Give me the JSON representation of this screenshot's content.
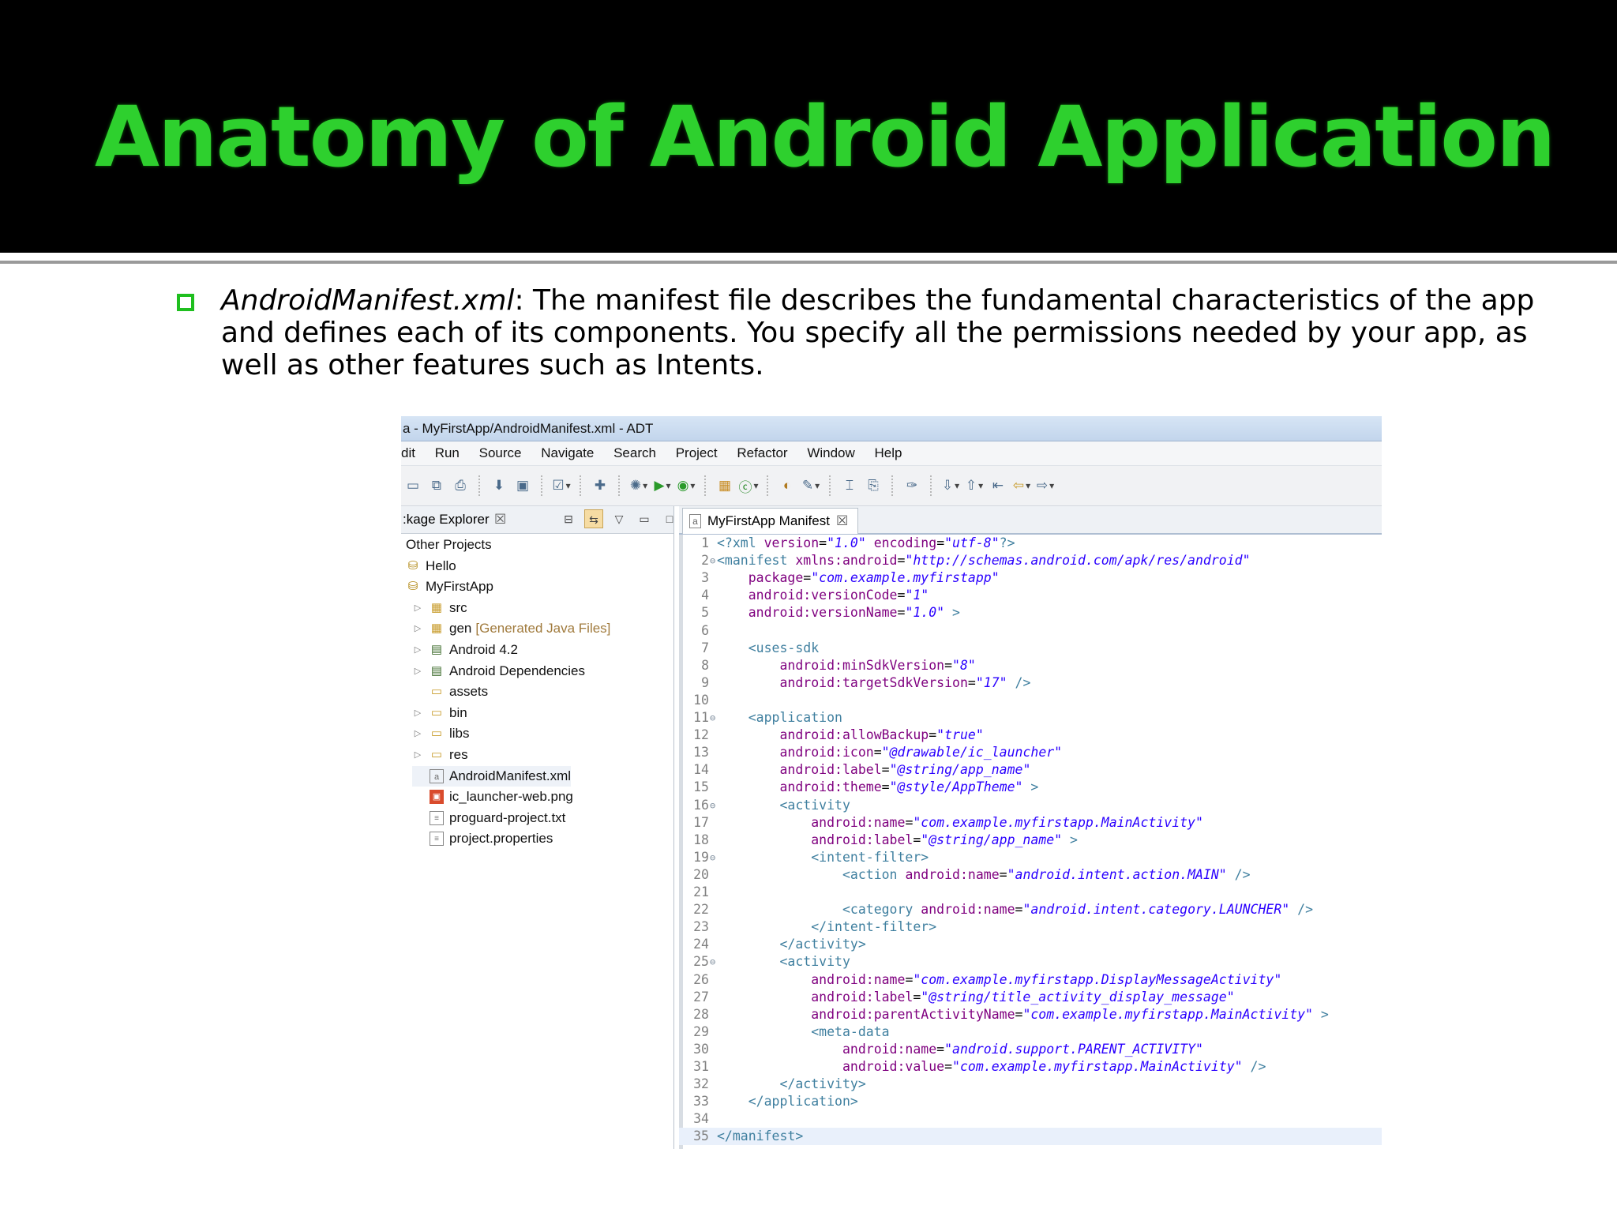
{
  "slide": {
    "title": "Anatomy of Android Application",
    "bullet": {
      "term": "AndroidManifest.xml",
      "text": ": The manifest file describes the fundamental characteristics of the app and defines each of its components. You specify all the permissions needed by your app, as well as other features such as Intents."
    }
  },
  "ide": {
    "window_title": "a - MyFirstApp/AndroidManifest.xml - ADT",
    "menu": [
      "dit",
      "Run",
      "Source",
      "Navigate",
      "Search",
      "Project",
      "Refactor",
      "Window",
      "Help"
    ],
    "package_explorer": {
      "tab_label": ":kage Explorer",
      "tree": [
        {
          "label": "Other Projects",
          "icon": "none",
          "level": 0,
          "expander": false
        },
        {
          "label": "Hello",
          "icon": "project-icon",
          "level": 0,
          "expander": false
        },
        {
          "label": "MyFirstApp",
          "icon": "project-icon",
          "level": 0,
          "expander": false
        },
        {
          "label": "src",
          "icon": "source-folder-icon",
          "level": 1,
          "expander": true
        },
        {
          "label": "gen",
          "decoration": "[Generated Java Files]",
          "icon": "source-folder-icon",
          "level": 1,
          "expander": true
        },
        {
          "label": "Android 4.2",
          "icon": "library-icon",
          "level": 1,
          "expander": true
        },
        {
          "label": "Android Dependencies",
          "icon": "library-icon",
          "level": 1,
          "expander": true
        },
        {
          "label": "assets",
          "icon": "folder-icon",
          "level": 1,
          "expander": false
        },
        {
          "label": "bin",
          "icon": "folder-icon",
          "level": 1,
          "expander": true
        },
        {
          "label": "libs",
          "icon": "folder-icon",
          "level": 1,
          "expander": true
        },
        {
          "label": "res",
          "icon": "folder-icon",
          "level": 1,
          "expander": true
        },
        {
          "label": "AndroidManifest.xml",
          "icon": "xml-file-icon",
          "level": 1,
          "expander": false,
          "selected": true
        },
        {
          "label": "ic_launcher-web.png",
          "icon": "image-file-icon",
          "level": 1,
          "expander": false
        },
        {
          "label": "proguard-project.txt",
          "icon": "text-file-icon",
          "level": 1,
          "expander": false
        },
        {
          "label": "project.properties",
          "icon": "text-file-icon",
          "level": 1,
          "expander": false
        }
      ]
    },
    "editor": {
      "tab_label": "MyFirstApp Manifest",
      "lines": [
        [
          {
            "c": "t",
            "s": "<?xml "
          },
          {
            "c": "a",
            "s": "version"
          },
          {
            "c": "p",
            "s": "="
          },
          {
            "c": "v",
            "s": "\"1.0\""
          },
          {
            "c": "p",
            "s": " "
          },
          {
            "c": "a",
            "s": "encoding"
          },
          {
            "c": "p",
            "s": "="
          },
          {
            "c": "v",
            "s": "\"utf-8\""
          },
          {
            "c": "t",
            "s": "?>"
          }
        ],
        [
          {
            "c": "t",
            "s": "<manifest "
          },
          {
            "c": "a",
            "s": "xmlns:android"
          },
          {
            "c": "p",
            "s": "="
          },
          {
            "c": "v",
            "s": "\"http://schemas.android.com/apk/res/android\""
          }
        ],
        [
          {
            "c": "p",
            "s": "    "
          },
          {
            "c": "a",
            "s": "package"
          },
          {
            "c": "p",
            "s": "="
          },
          {
            "c": "v",
            "s": "\"com.example.myfirstapp\""
          }
        ],
        [
          {
            "c": "p",
            "s": "    "
          },
          {
            "c": "a",
            "s": "android:versionCode"
          },
          {
            "c": "p",
            "s": "="
          },
          {
            "c": "v",
            "s": "\"1\""
          }
        ],
        [
          {
            "c": "p",
            "s": "    "
          },
          {
            "c": "a",
            "s": "android:versionName"
          },
          {
            "c": "p",
            "s": "="
          },
          {
            "c": "v",
            "s": "\"1.0\""
          },
          {
            "c": "t",
            "s": " >"
          }
        ],
        [],
        [
          {
            "c": "p",
            "s": "    "
          },
          {
            "c": "t",
            "s": "<uses-sdk"
          }
        ],
        [
          {
            "c": "p",
            "s": "        "
          },
          {
            "c": "a",
            "s": "android:minSdkVersion"
          },
          {
            "c": "p",
            "s": "="
          },
          {
            "c": "v",
            "s": "\"8\""
          }
        ],
        [
          {
            "c": "p",
            "s": "        "
          },
          {
            "c": "a",
            "s": "android:targetSdkVersion"
          },
          {
            "c": "p",
            "s": "="
          },
          {
            "c": "v",
            "s": "\"17\""
          },
          {
            "c": "t",
            "s": " />"
          }
        ],
        [],
        [
          {
            "c": "p",
            "s": "    "
          },
          {
            "c": "t",
            "s": "<application"
          }
        ],
        [
          {
            "c": "p",
            "s": "        "
          },
          {
            "c": "a",
            "s": "android:allowBackup"
          },
          {
            "c": "p",
            "s": "="
          },
          {
            "c": "v",
            "s": "\"true\""
          }
        ],
        [
          {
            "c": "p",
            "s": "        "
          },
          {
            "c": "a",
            "s": "android:icon"
          },
          {
            "c": "p",
            "s": "="
          },
          {
            "c": "v",
            "s": "\"@drawable/ic_launcher\""
          }
        ],
        [
          {
            "c": "p",
            "s": "        "
          },
          {
            "c": "a",
            "s": "android:label"
          },
          {
            "c": "p",
            "s": "="
          },
          {
            "c": "v",
            "s": "\"@string/app_name\""
          }
        ],
        [
          {
            "c": "p",
            "s": "        "
          },
          {
            "c": "a",
            "s": "android:theme"
          },
          {
            "c": "p",
            "s": "="
          },
          {
            "c": "v",
            "s": "\"@style/AppTheme\""
          },
          {
            "c": "t",
            "s": " >"
          }
        ],
        [
          {
            "c": "p",
            "s": "        "
          },
          {
            "c": "t",
            "s": "<activity"
          }
        ],
        [
          {
            "c": "p",
            "s": "            "
          },
          {
            "c": "a",
            "s": "android:name"
          },
          {
            "c": "p",
            "s": "="
          },
          {
            "c": "v",
            "s": "\"com.example.myfirstapp.MainActivity\""
          }
        ],
        [
          {
            "c": "p",
            "s": "            "
          },
          {
            "c": "a",
            "s": "android:label"
          },
          {
            "c": "p",
            "s": "="
          },
          {
            "c": "v",
            "s": "\"@string/app_name\""
          },
          {
            "c": "t",
            "s": " >"
          }
        ],
        [
          {
            "c": "p",
            "s": "            "
          },
          {
            "c": "t",
            "s": "<intent-filter>"
          }
        ],
        [
          {
            "c": "p",
            "s": "                "
          },
          {
            "c": "t",
            "s": "<action "
          },
          {
            "c": "a",
            "s": "android:name"
          },
          {
            "c": "p",
            "s": "="
          },
          {
            "c": "v",
            "s": "\"android.intent.action.MAIN\""
          },
          {
            "c": "t",
            "s": " />"
          }
        ],
        [],
        [
          {
            "c": "p",
            "s": "                "
          },
          {
            "c": "t",
            "s": "<category "
          },
          {
            "c": "a",
            "s": "android:name"
          },
          {
            "c": "p",
            "s": "="
          },
          {
            "c": "v",
            "s": "\"android.intent.category.LAUNCHER\""
          },
          {
            "c": "t",
            "s": " />"
          }
        ],
        [
          {
            "c": "p",
            "s": "            "
          },
          {
            "c": "t",
            "s": "</intent-filter>"
          }
        ],
        [
          {
            "c": "p",
            "s": "        "
          },
          {
            "c": "t",
            "s": "</activity>"
          }
        ],
        [
          {
            "c": "p",
            "s": "        "
          },
          {
            "c": "t",
            "s": "<activity"
          }
        ],
        [
          {
            "c": "p",
            "s": "            "
          },
          {
            "c": "a",
            "s": "android:name"
          },
          {
            "c": "p",
            "s": "="
          },
          {
            "c": "v",
            "s": "\"com.example.myfirstapp.DisplayMessageActivity\""
          }
        ],
        [
          {
            "c": "p",
            "s": "            "
          },
          {
            "c": "a",
            "s": "android:label"
          },
          {
            "c": "p",
            "s": "="
          },
          {
            "c": "v",
            "s": "\"@string/title_activity_display_message\""
          }
        ],
        [
          {
            "c": "p",
            "s": "            "
          },
          {
            "c": "a",
            "s": "android:parentActivityName"
          },
          {
            "c": "p",
            "s": "="
          },
          {
            "c": "v",
            "s": "\"com.example.myfirstapp.MainActivity\""
          },
          {
            "c": "t",
            "s": " >"
          }
        ],
        [
          {
            "c": "p",
            "s": "            "
          },
          {
            "c": "t",
            "s": "<meta-data"
          }
        ],
        [
          {
            "c": "p",
            "s": "                "
          },
          {
            "c": "a",
            "s": "android:name"
          },
          {
            "c": "p",
            "s": "="
          },
          {
            "c": "v",
            "s": "\"android.support.PARENT_ACTIVITY\""
          }
        ],
        [
          {
            "c": "p",
            "s": "                "
          },
          {
            "c": "a",
            "s": "android:value"
          },
          {
            "c": "p",
            "s": "="
          },
          {
            "c": "v",
            "s": "\"com.example.myfirstapp.MainActivity\""
          },
          {
            "c": "t",
            "s": " />"
          }
        ],
        [
          {
            "c": "p",
            "s": "        "
          },
          {
            "c": "t",
            "s": "</activity>"
          }
        ],
        [
          {
            "c": "p",
            "s": "    "
          },
          {
            "c": "t",
            "s": "</application>"
          }
        ],
        [],
        [
          {
            "c": "t",
            "s": "</manifest>"
          }
        ]
      ],
      "folded_lines": [
        2,
        11,
        16,
        19,
        25
      ],
      "current_line": 35
    }
  },
  "colors": {
    "title_green": "#2ed02e",
    "bullet_green": "#1fbf1f",
    "xml_tag": "#3f7f9f",
    "xml_attr": "#7f007f",
    "xml_value": "#2a00ff"
  }
}
